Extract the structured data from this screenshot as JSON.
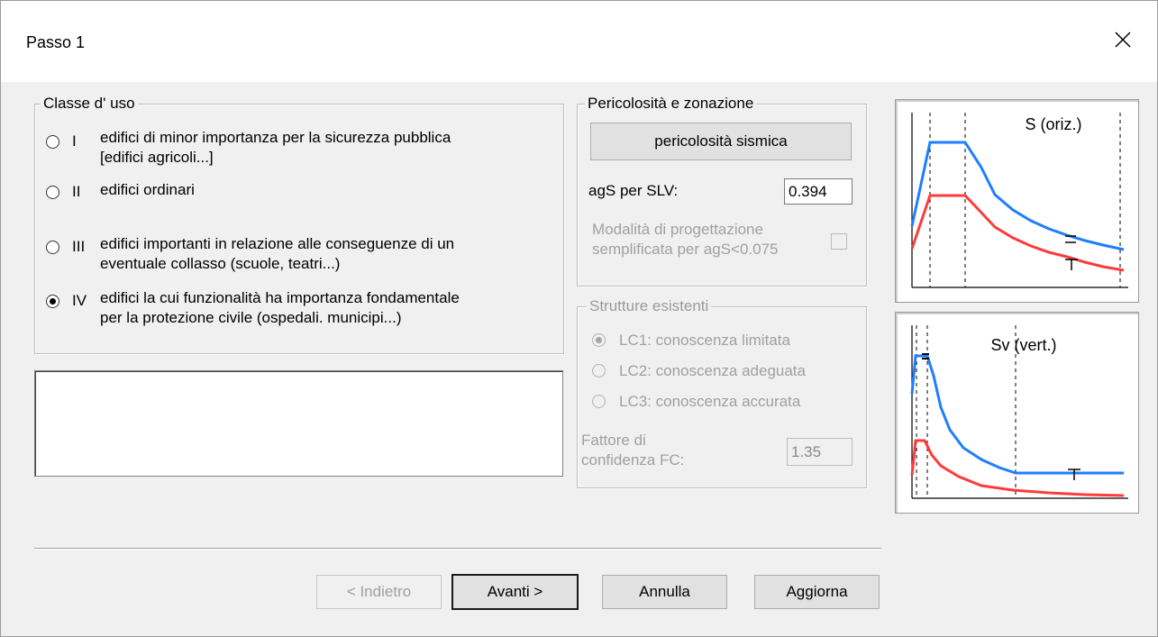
{
  "dialog": {
    "title": "Passo 1"
  },
  "classe_uso": {
    "legend": "Classe d' uso",
    "options": [
      {
        "numeral": "I",
        "line1": "edifici di minor importanza per la sicurezza pubblica",
        "line2": "[edifici agricoli...]",
        "selected": false
      },
      {
        "numeral": "II",
        "line1": "edifici ordinari",
        "line2": "",
        "selected": false
      },
      {
        "numeral": "III",
        "line1": "edifici importanti in relazione alle conseguenze di un",
        "line2": "eventuale collasso (scuole, teatri...)",
        "selected": false
      },
      {
        "numeral": "IV",
        "line1": "edifici la cui funzionalità ha importanza fondamentale",
        "line2": "per la protezione civile (ospedali. municipi...)",
        "selected": true
      }
    ]
  },
  "pericolosita": {
    "legend": "Pericolosità e zonazione",
    "button_label": "pericolosità sismica",
    "ags_label": "agS per SLV:",
    "ags_value": "0.394",
    "modalita_line1": "Modalità di progettazione",
    "modalita_line2": "semplificata per agS<0.075"
  },
  "strutture": {
    "legend": "Strutture esistenti",
    "options": [
      {
        "label": "LC1: conoscenza limitata",
        "selected": true
      },
      {
        "label": "LC2: conoscenza adeguata",
        "selected": false
      },
      {
        "label": "LC3: conoscenza accurata",
        "selected": false
      }
    ],
    "fattore_line1": "Fattore di",
    "fattore_line2": "confidenza FC:",
    "fattore_value": "1.35"
  },
  "charts": {
    "horizontal_title": "S (oriz.)",
    "vertical_title": "Sv (vert.)",
    "blue": "#1e7fff",
    "red": "#ff3b3b"
  },
  "buttons": {
    "back": "< Indietro",
    "next": "Avanti >",
    "cancel": "Annulla",
    "update": "Aggiorna"
  }
}
